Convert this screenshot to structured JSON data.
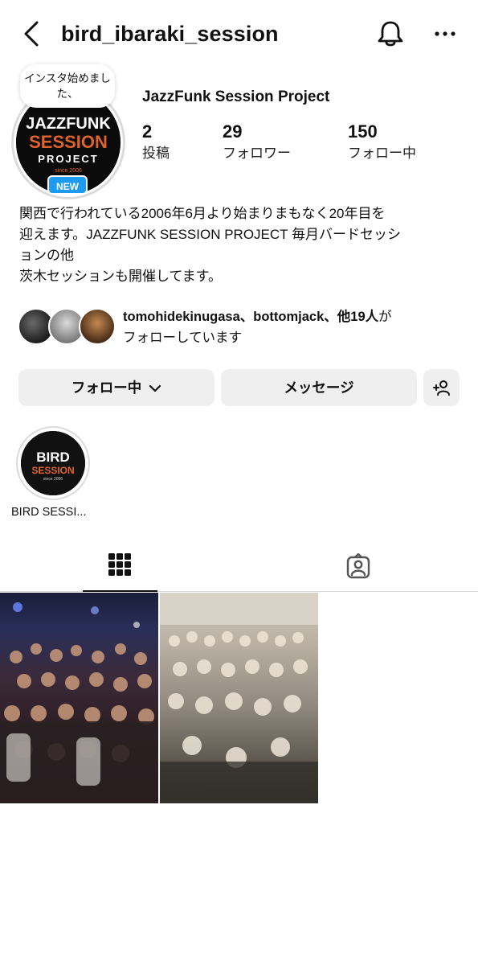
{
  "header": {
    "username": "bird_ibaraki_session"
  },
  "profile": {
    "note": "インスタ始めました、",
    "new_badge": "NEW",
    "avatar_logo": {
      "line1": "JAZZFUNK",
      "line2": "SESSION",
      "line3": "PROJECT",
      "line4": "since 2006"
    },
    "display_name": "JazzFunk Session Project",
    "stats": [
      {
        "value": "2",
        "label": "投稿"
      },
      {
        "value": "29",
        "label": "フォロワー"
      },
      {
        "value": "150",
        "label": "フォロー中"
      }
    ],
    "bio_lines": [
      "関西で行われている2006年6月より始まりまもなく20年目を",
      "迎えます。JAZZFUNK SESSION PROJECT 毎月バードセッシ",
      "ョンの他",
      "茨木セッションも開催してます。"
    ]
  },
  "mutual": {
    "names": "tomohidekinugasa、bottomjack、他19人",
    "suffix_line1": "が",
    "line2": "フォローしています"
  },
  "actions": {
    "follow_label": "フォロー中",
    "message_label": "メッセージ"
  },
  "highlight": {
    "logo_line1": "BIRD",
    "logo_line2": "SESSION",
    "logo_line3": "since 2006",
    "label": "BIRD SESSI..."
  },
  "colors": {
    "accent_blue": "#1d9bf0",
    "button_bg": "#efefef",
    "logo_orange": "#e0622b"
  },
  "icons": [
    "chevron-left-icon",
    "bell-icon",
    "more-icon",
    "chevron-down-icon",
    "add-person-icon",
    "grid-icon",
    "tagged-icon"
  ]
}
